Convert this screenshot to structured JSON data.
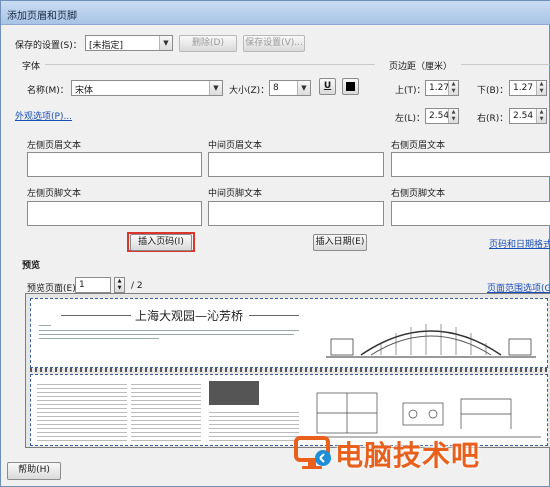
{
  "window": {
    "title": "添加页眉和页脚"
  },
  "saved_settings": {
    "label": "保存的设置(S)：",
    "value": "[未指定]",
    "delete_label": "删除(D)",
    "save_label": "保存设置(V)..."
  },
  "font": {
    "section_label": "字体",
    "name_label": "名称(M)：",
    "name_value": "宋体",
    "size_label": "大小(Z)：",
    "size_value": "8",
    "underline_label": "U"
  },
  "appearance_link": "外观选项(P)...",
  "margins": {
    "section_label": "页边距（厘米）",
    "top_label": "上(T)：",
    "top_value": "1.27",
    "bottom_label": "下(B)：",
    "bottom_value": "1.27",
    "left_label": "左(L)：",
    "left_value": "2.54",
    "right_label": "右(R)：",
    "right_value": "2.54"
  },
  "header_footer": {
    "left_header": "左侧页眉文本",
    "center_header": "中间页眉文本",
    "right_header": "右侧页眉文本",
    "left_footer": "左侧页脚文本",
    "center_footer": "中间页脚文本",
    "right_footer": "右侧页脚文本"
  },
  "insert_page_number": "插入页码(I)",
  "insert_date": "插入日期(E)",
  "page_date_format_link": "页码和日期格式(",
  "preview": {
    "section_label": "预览",
    "page_label": "预览页面(E)",
    "page_value": "1",
    "page_total": "/ 2",
    "page_range_link": "页面范围选项(G...",
    "doc_title": "上海大观园—沁芳桥"
  },
  "help_label": "帮助(H)",
  "watermark_text": "电脑技术吧",
  "colors": {
    "highlight": "#d9362c",
    "watermark": "#e8601c",
    "link": "#1a4fb5"
  }
}
